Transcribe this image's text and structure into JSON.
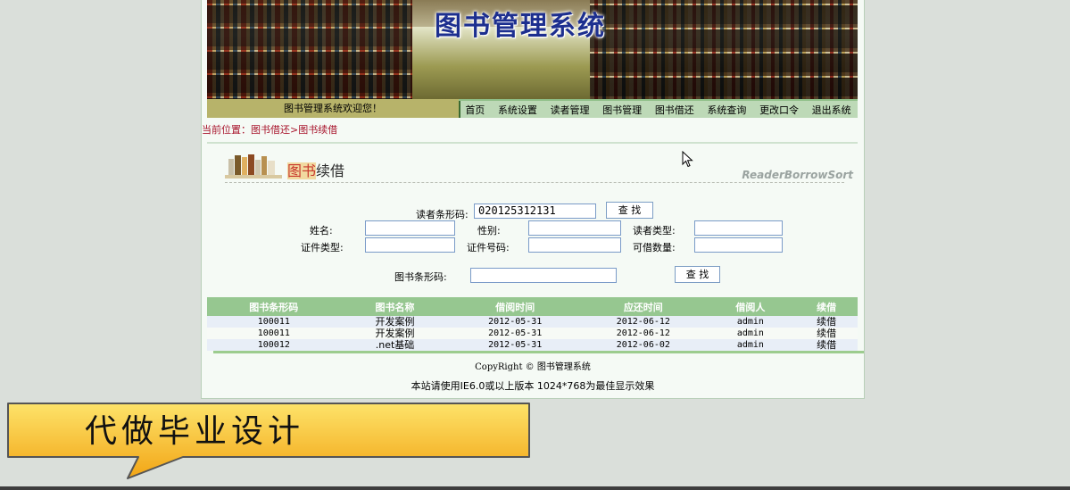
{
  "banner": {
    "title": "图书管理系统"
  },
  "nav": {
    "welcome": "图书管理系统欢迎您！",
    "items": [
      "首页",
      "系统设置",
      "读者管理",
      "图书管理",
      "图书借还",
      "系统查询",
      "更改口令",
      "退出系统"
    ]
  },
  "breadcrumb": "当前位置：图书借还>图书续借",
  "section": {
    "title_prefix": "图书",
    "title_suffix": "续借",
    "subtitle": "ReaderBorrowSort"
  },
  "reader_search": {
    "barcode_label": "读者条形码:",
    "barcode_value": "020125312131",
    "search_button": "查  找"
  },
  "reader_info": {
    "name_label": "姓名:",
    "gender_label": "性别:",
    "type_label": "读者类型:",
    "id_type_label": "证件类型:",
    "id_number_label": "证件号码:",
    "borrow_limit_label": "可借数量:"
  },
  "book_search": {
    "barcode_label": "图书条形码:",
    "search_button": "查  找"
  },
  "table": {
    "headers": [
      "图书条形码",
      "图书名称",
      "借阅时间",
      "应还时间",
      "借阅人",
      "续借"
    ],
    "rows": [
      [
        "100011",
        "开发案例",
        "2012-05-31",
        "2012-06-12",
        "admin",
        "续借"
      ],
      [
        "100011",
        "开发案例",
        "2012-05-31",
        "2012-06-12",
        "admin",
        "续借"
      ],
      [
        "100012",
        ".net基础",
        "2012-05-31",
        "2012-06-02",
        "admin",
        "续借"
      ]
    ]
  },
  "footer": {
    "copyright": "CopyRight © 图书管理系统",
    "note": "本站请使用IE6.0或以上版本 1024*768为最佳显示效果"
  },
  "callout": {
    "text": "代做毕业设计"
  },
  "colors": {
    "nav_bg": "#bdd9b7",
    "welcome_bg": "#b7b36a",
    "table_header": "#96c790",
    "breadcrumb": "#a8142c"
  }
}
